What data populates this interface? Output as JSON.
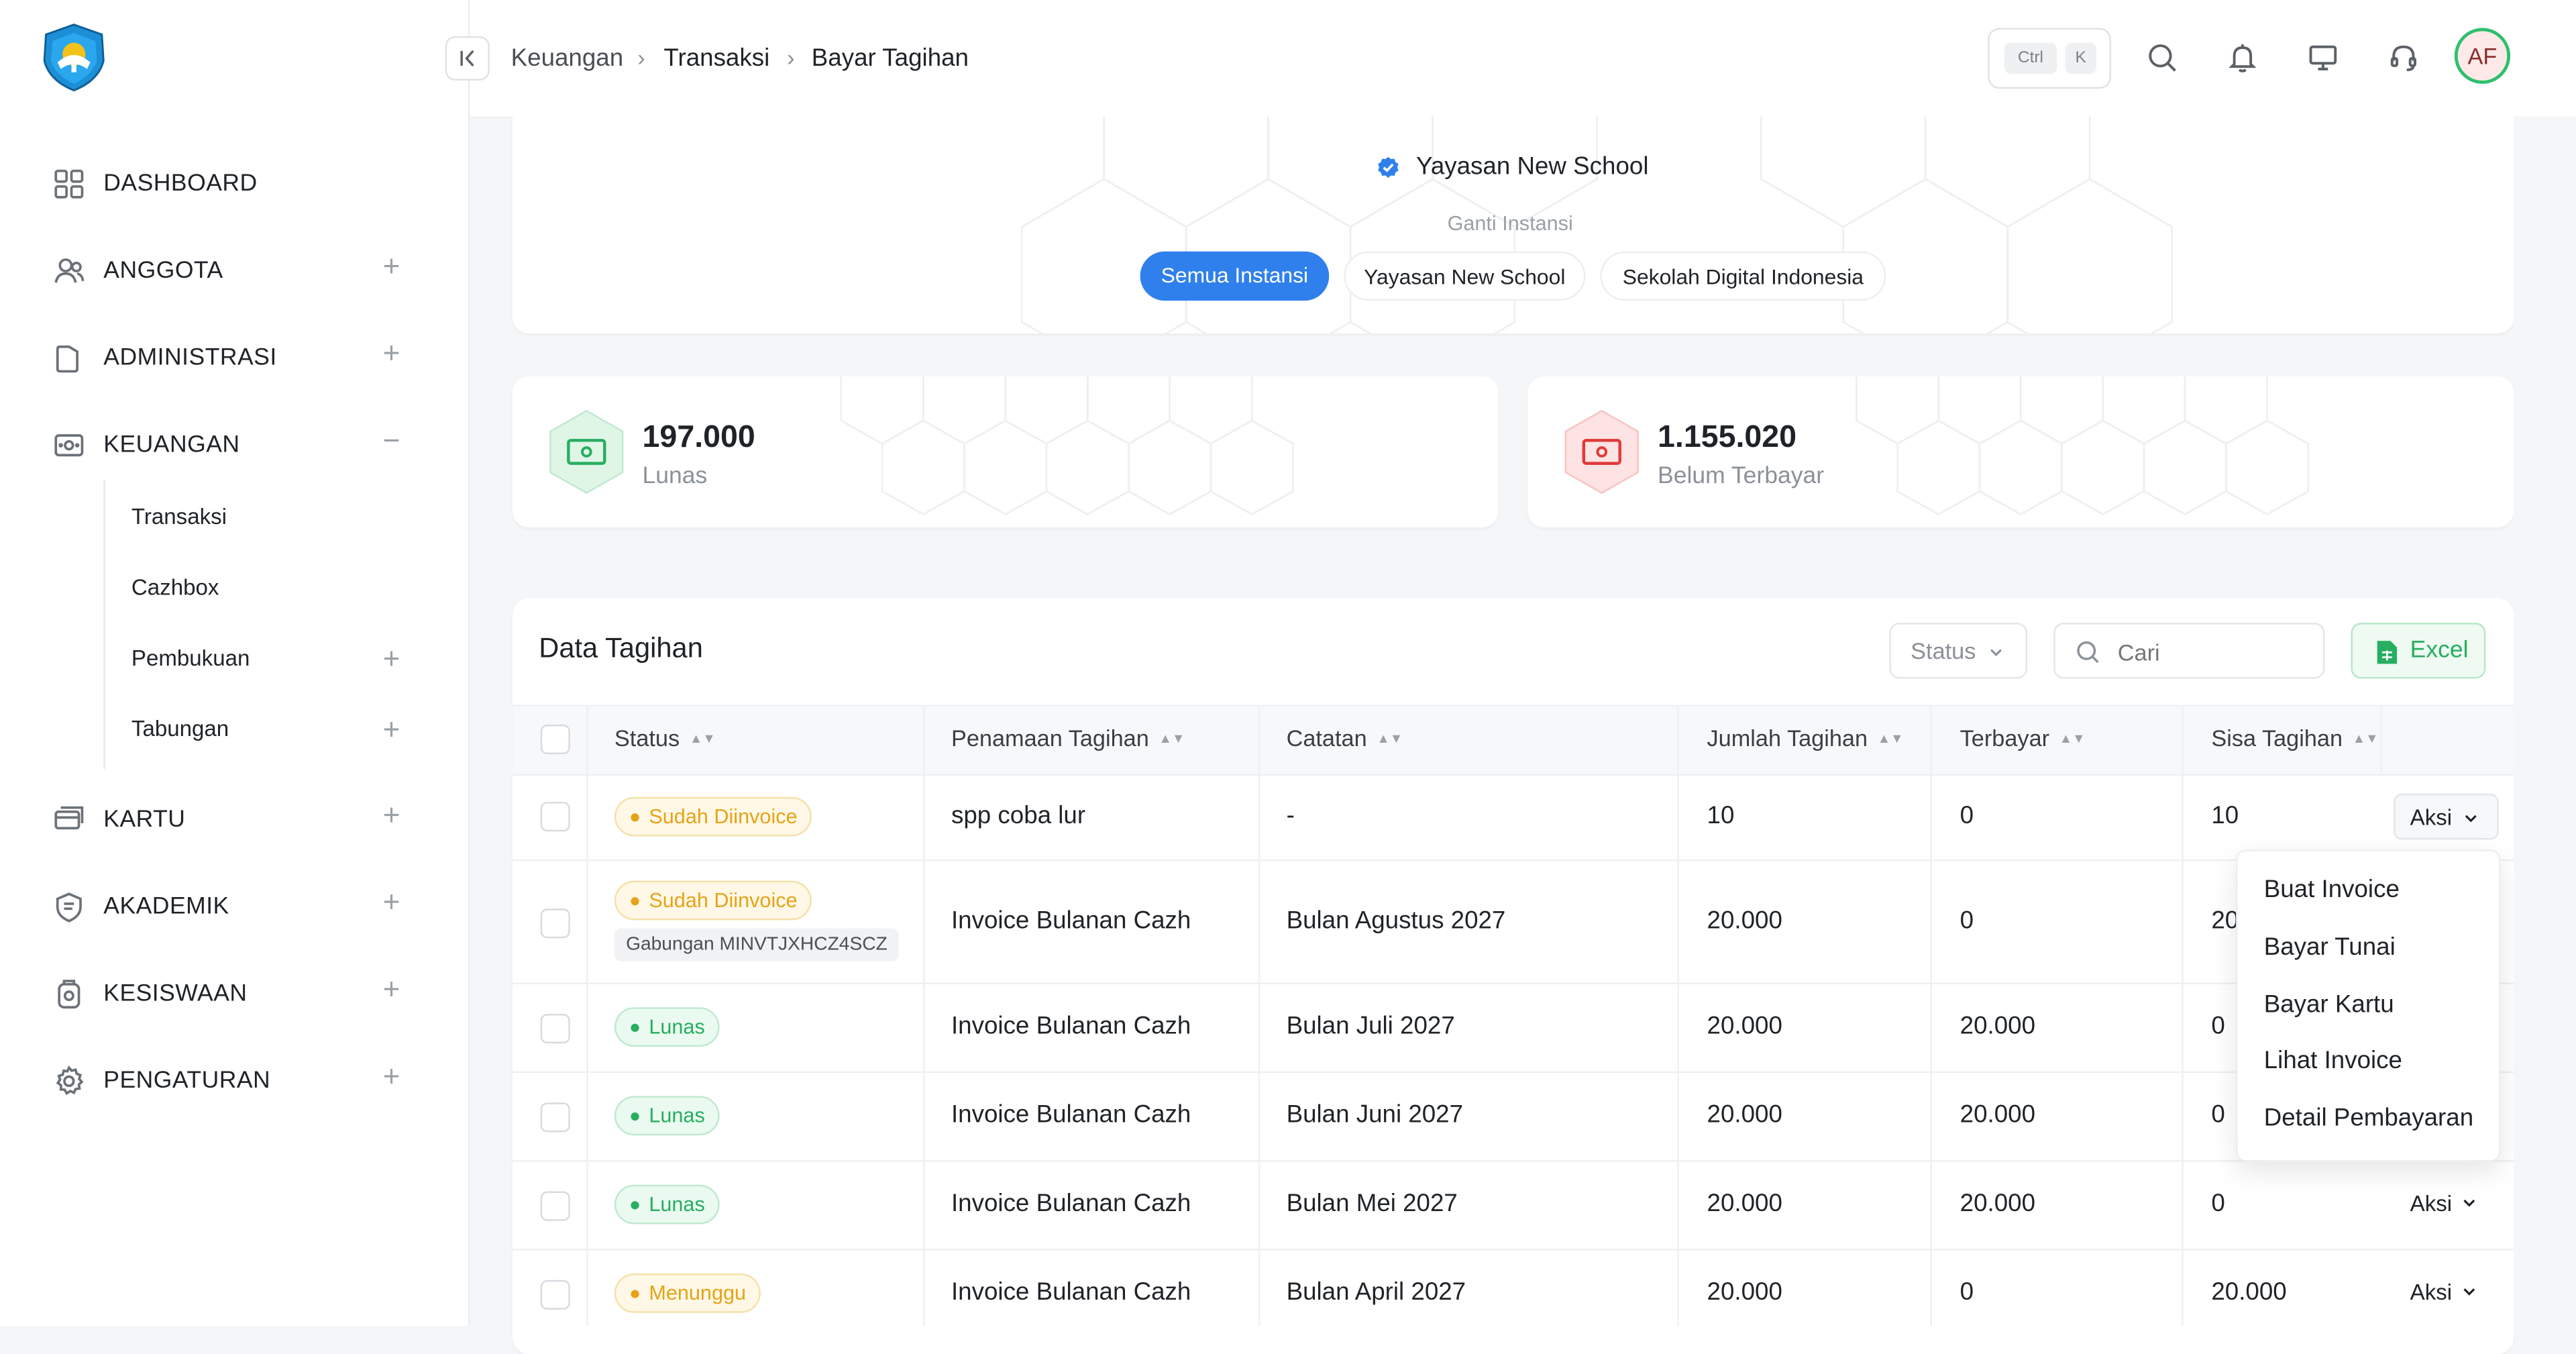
{
  "sidebar": {
    "items": [
      {
        "label": "DASHBOARD"
      },
      {
        "label": "ANGGOTA"
      },
      {
        "label": "ADMINISTRASI"
      },
      {
        "label": "KEUANGAN"
      },
      {
        "label": "KARTU"
      },
      {
        "label": "AKADEMIK"
      },
      {
        "label": "KESISWAAN"
      },
      {
        "label": "PENGATURAN"
      }
    ],
    "keuangan_sub": [
      {
        "label": "Transaksi"
      },
      {
        "label": "Cazhbox"
      },
      {
        "label": "Pembukuan"
      },
      {
        "label": "Tabungan"
      }
    ]
  },
  "header": {
    "breadcrumb": [
      "Keuangan",
      "Transaksi",
      "Bayar Tagihan"
    ],
    "shortcut_keys": [
      "Ctrl",
      "K"
    ],
    "avatar_initials": "AF",
    "icons": [
      "search-icon",
      "bell-icon",
      "monitor-icon",
      "headset-icon"
    ]
  },
  "instansi": {
    "name": "Yayasan New School",
    "switch_label": "Ganti Instansi",
    "options": [
      "Semua Instansi",
      "Yayasan New School",
      "Sekolah Digital Indonesia"
    ],
    "selected": "Semua Instansi"
  },
  "stats": {
    "lunas": {
      "value": "197.000",
      "label": "Lunas"
    },
    "belum": {
      "value": "1.155.020",
      "label": "Belum Terbayar"
    }
  },
  "table": {
    "title": "Data Tagihan",
    "status_filter": "Status",
    "search_placeholder": "Cari",
    "excel_label": "Excel",
    "columns": [
      "Status",
      "Penamaan Tagihan",
      "Catatan",
      "Jumlah Tagihan",
      "Terbayar",
      "Sisa Tagihan"
    ],
    "rows": [
      {
        "status": "Sudah Diinvoice",
        "name": "spp coba lur",
        "note": "-",
        "amount": "10",
        "paid": "0",
        "remaining": "10",
        "action": "Aksi"
      },
      {
        "status": "Sudah Diinvoice",
        "tag": "Gabungan MINVTJXHCZ4SCZ",
        "name": "Invoice Bulanan Cazh",
        "note": "Bulan Agustus 2027",
        "amount": "20.000",
        "paid": "0",
        "remaining": "20"
      },
      {
        "status": "Lunas",
        "name": "Invoice Bulanan Cazh",
        "note": "Bulan Juli 2027",
        "amount": "20.000",
        "paid": "20.000",
        "remaining": "0"
      },
      {
        "status": "Lunas",
        "name": "Invoice Bulanan Cazh",
        "note": "Bulan Juni 2027",
        "amount": "20.000",
        "paid": "20.000",
        "remaining": "0"
      },
      {
        "status": "Lunas",
        "name": "Invoice Bulanan Cazh",
        "note": "Bulan Mei 2027",
        "amount": "20.000",
        "paid": "20.000",
        "remaining": "0",
        "action": "Aksi"
      },
      {
        "status": "Menunggu",
        "name": "Invoice Bulanan Cazh",
        "note": "Bulan April 2027",
        "amount": "20.000",
        "paid": "0",
        "remaining": "20.000",
        "action": "Aksi"
      }
    ],
    "action_menu": [
      "Buat Invoice",
      "Bayar Tunai",
      "Bayar Kartu",
      "Lihat Invoice",
      "Detail Pembayaran"
    ]
  },
  "colors": {
    "primary": "#2f80ed",
    "success": "#27ae60",
    "warning": "#e6a317",
    "danger": "#e03a3a"
  }
}
